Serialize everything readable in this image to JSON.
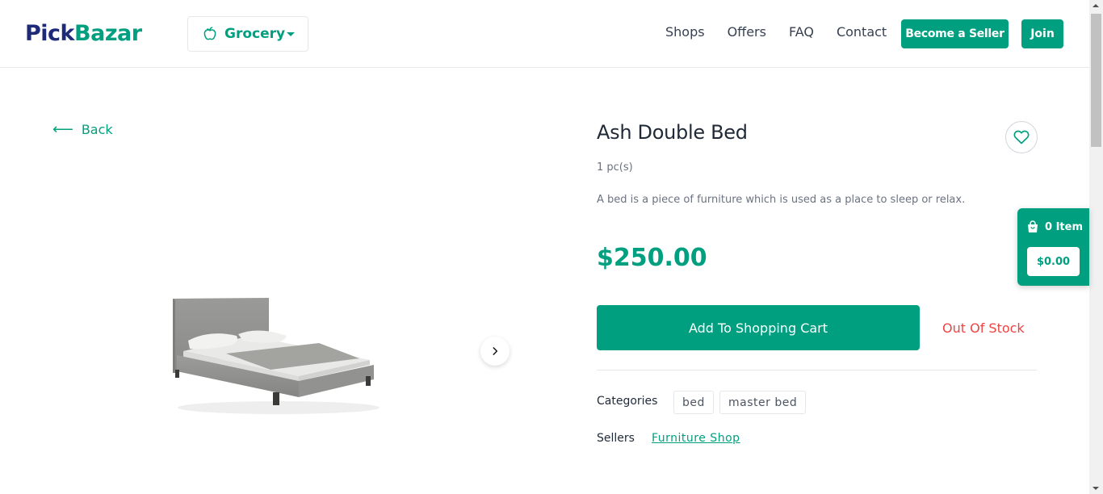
{
  "header": {
    "logo": {
      "part1": "Pick",
      "part2": "Bazar"
    },
    "shop_select": {
      "label": "Grocery",
      "icon": "apple-icon"
    },
    "nav": [
      "Shops",
      "Offers",
      "FAQ",
      "Contact"
    ],
    "become_seller": "Become a Seller",
    "join": "Join"
  },
  "back": {
    "arrow": "⟵",
    "label": "Back"
  },
  "product": {
    "title": "Ash Double Bed",
    "unit": "1 pc(s)",
    "description": "A bed is a piece of furniture which is used as a place to sleep or relax.",
    "price": "$250.00",
    "add_to_cart": "Add To Shopping Cart",
    "stock_status": "Out Of Stock",
    "categories_label": "Categories",
    "categories": [
      "bed",
      "master bed"
    ],
    "sellers_label": "Sellers",
    "seller": "Furniture Shop"
  },
  "cart": {
    "items": "0 Item",
    "total": "$0.00"
  },
  "colors": {
    "accent": "#009f7f",
    "logo_dark": "#1e2a78",
    "out_of_stock": "#ef4444"
  }
}
